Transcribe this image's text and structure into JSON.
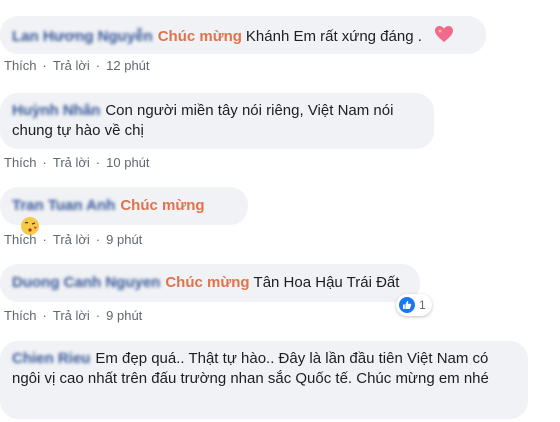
{
  "comments": [
    {
      "author": "Lan Hương Nguyễn",
      "tag": "Chúc mừng",
      "text": "Khánh Em rất xứng đáng .",
      "emoji": "heart-with-sparkles-emoji",
      "actions": {
        "like": "Thích",
        "reply": "Trả lời",
        "time": "12 phút"
      }
    },
    {
      "author": "Huỳnh Nhân",
      "tag": "",
      "text": "Con người miền tây nói riêng, Việt Nam nói chung tự hào về chị",
      "actions": {
        "like": "Thích",
        "reply": "Trả lời",
        "time": "10 phút"
      }
    },
    {
      "author": "Tran Tuan Anh",
      "tag": "Chúc mừng",
      "text": "",
      "emoji": "face-blowing-kiss-emoji",
      "actions": {
        "like": "Thích",
        "reply": "Trả lời",
        "time": "9 phút"
      }
    },
    {
      "author": "Duong Canh Nguyen",
      "tag": "Chúc mừng",
      "text": "Tân Hoa Hậu Trái Đất",
      "reaction_count": "1",
      "actions": {
        "like": "Thích",
        "reply": "Trả lời",
        "time": "9 phút"
      }
    },
    {
      "author": "Chien Rieu",
      "tag": "",
      "text": "Em đẹp quá.. Thật tự hào.. Đây là lần đầu tiên Việt Nam có ngôi vị cao nhất trên đấu trường nhan sắc Quốc tế. Chúc mừng em nhé",
      "actions": {}
    }
  ],
  "colors": {
    "author": "#385898",
    "tag": "#e0734b",
    "bubble": "#f0f2f5",
    "like_blue": "#1877f2"
  }
}
